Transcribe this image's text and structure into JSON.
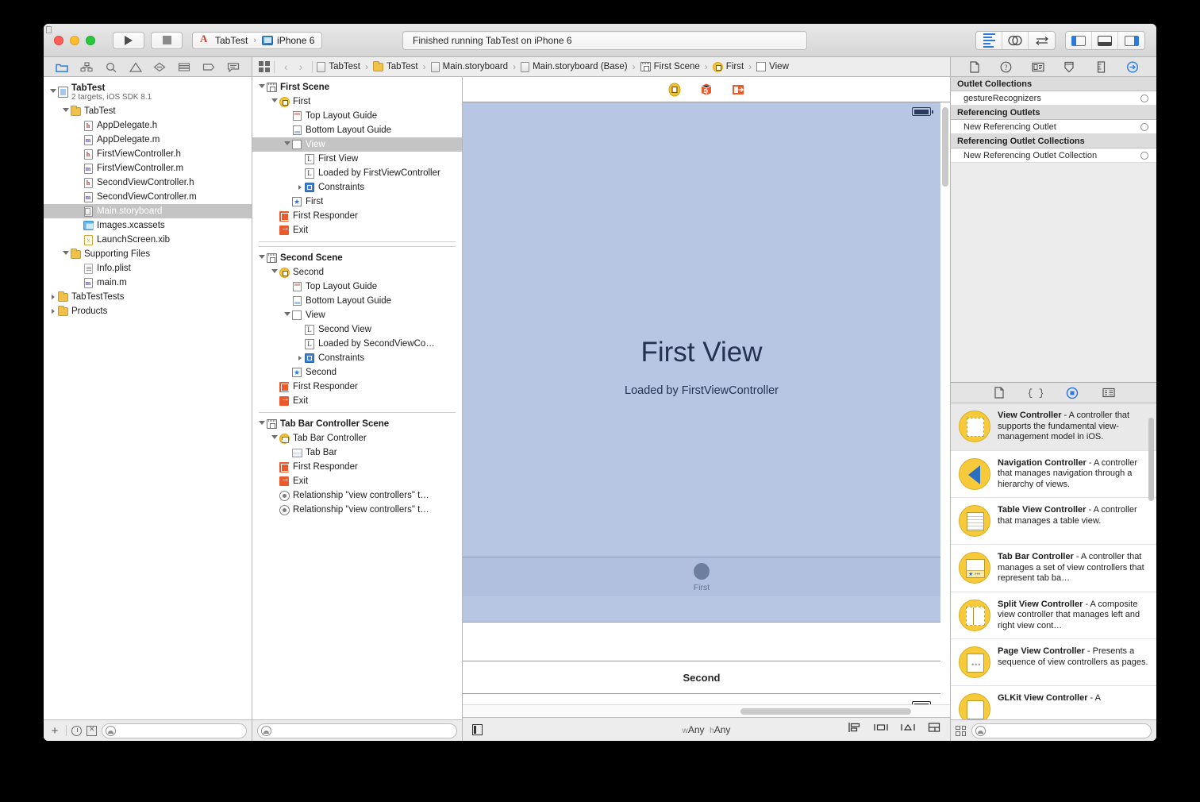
{
  "window": {
    "traffic_lights": [
      "close",
      "minimize",
      "zoom"
    ],
    "run_button": "run",
    "stop_button": "stop",
    "scheme": {
      "project": "TabTest",
      "separator": "›",
      "destination": "iPhone 6"
    },
    "status": "Finished running TabTest on iPhone 6",
    "editor_modes": [
      "standard-editor",
      "assistant-editor",
      "version-editor"
    ],
    "view_toggles": [
      "navigator-toggle",
      "debug-area-toggle",
      "utilities-toggle"
    ]
  },
  "navigator": {
    "tabs": [
      "project-navigator",
      "symbol-navigator",
      "find-navigator",
      "issue-navigator",
      "test-navigator",
      "debug-navigator",
      "breakpoint-navigator",
      "report-navigator"
    ],
    "tree": [
      {
        "label": "TabTest",
        "sublabel": "2 targets, iOS SDK 8.1",
        "icon": "project-icon",
        "depth": 0,
        "twisty": "open",
        "bold": true,
        "selected": false
      },
      {
        "label": "TabTest",
        "icon": "folder-icon",
        "depth": 1,
        "twisty": "open",
        "selected": false
      },
      {
        "label": "AppDelegate.h",
        "icon": "header-file-icon",
        "depth": 2,
        "twisty": "none",
        "selected": false
      },
      {
        "label": "AppDelegate.m",
        "icon": "source-file-icon",
        "depth": 2,
        "twisty": "none",
        "selected": false
      },
      {
        "label": "FirstViewController.h",
        "icon": "header-file-icon",
        "depth": 2,
        "twisty": "none",
        "selected": false
      },
      {
        "label": "FirstViewController.m",
        "icon": "source-file-icon",
        "depth": 2,
        "twisty": "none",
        "selected": false
      },
      {
        "label": "SecondViewController.h",
        "icon": "header-file-icon",
        "depth": 2,
        "twisty": "none",
        "selected": false
      },
      {
        "label": "SecondViewController.m",
        "icon": "source-file-icon",
        "depth": 2,
        "twisty": "none",
        "selected": false
      },
      {
        "label": "Main.storyboard",
        "icon": "storyboard-file-icon",
        "depth": 2,
        "twisty": "none",
        "selected": true
      },
      {
        "label": "Images.xcassets",
        "icon": "xcassets-icon",
        "depth": 2,
        "twisty": "none",
        "selected": false
      },
      {
        "label": "LaunchScreen.xib",
        "icon": "xib-file-icon",
        "depth": 2,
        "twisty": "none",
        "selected": false
      },
      {
        "label": "Supporting Files",
        "icon": "folder-icon",
        "depth": 1,
        "twisty": "open",
        "selected": false
      },
      {
        "label": "Info.plist",
        "icon": "plist-file-icon",
        "depth": 2,
        "twisty": "none",
        "selected": false
      },
      {
        "label": "main.m",
        "icon": "source-file-icon",
        "depth": 2,
        "twisty": "none",
        "selected": false
      },
      {
        "label": "TabTestTests",
        "icon": "folder-icon",
        "depth": 0,
        "twisty": "closed",
        "selected": false
      },
      {
        "label": "Products",
        "icon": "folder-icon",
        "depth": 0,
        "twisty": "closed",
        "selected": false
      }
    ],
    "filter": {
      "add_label": "+",
      "placeholder": ""
    }
  },
  "breadcrumb": {
    "back": "‹",
    "forward": "›",
    "separator": "›",
    "items": [
      {
        "label": "TabTest",
        "icon": "project-icon"
      },
      {
        "label": "TabTest",
        "icon": "folder-icon"
      },
      {
        "label": "Main.storyboard",
        "icon": "storyboard-file-icon"
      },
      {
        "label": "Main.storyboard (Base)",
        "icon": "storyboard-file-icon"
      },
      {
        "label": "First Scene",
        "icon": "scene-icon"
      },
      {
        "label": "First",
        "icon": "view-controller-icon"
      },
      {
        "label": "View",
        "icon": "view-icon"
      }
    ]
  },
  "outline": {
    "scenes": [
      {
        "name": "First Scene",
        "rows": [
          {
            "label": "First Scene",
            "icon": "scene-icon",
            "depth": 0,
            "twisty": "open",
            "bold": true,
            "selected": false
          },
          {
            "label": "First",
            "icon": "view-controller-icon",
            "depth": 1,
            "twisty": "open",
            "selected": false
          },
          {
            "label": "Top Layout Guide",
            "icon": "top-layout-guide-icon",
            "depth": 2,
            "twisty": "none",
            "selected": false
          },
          {
            "label": "Bottom Layout Guide",
            "icon": "bottom-layout-guide-icon",
            "depth": 2,
            "twisty": "none",
            "selected": false
          },
          {
            "label": "View",
            "icon": "view-icon",
            "depth": 2,
            "twisty": "open",
            "selected": true
          },
          {
            "label": "First View",
            "icon": "label-icon",
            "depth": 3,
            "twisty": "none",
            "selected": false
          },
          {
            "label": "Loaded by FirstViewController",
            "icon": "label-icon",
            "depth": 3,
            "twisty": "none",
            "selected": false
          },
          {
            "label": "Constraints",
            "icon": "constraints-icon",
            "depth": 3,
            "twisty": "closed",
            "selected": false
          },
          {
            "label": "First",
            "icon": "tab-bar-item-icon",
            "depth": 2,
            "twisty": "none",
            "selected": false
          },
          {
            "label": "First Responder",
            "icon": "first-responder-icon",
            "depth": 1,
            "twisty": "none",
            "selected": false
          },
          {
            "label": "Exit",
            "icon": "exit-icon",
            "depth": 1,
            "twisty": "none",
            "selected": false
          }
        ]
      },
      {
        "name": "Second Scene",
        "rows": [
          {
            "label": "Second Scene",
            "icon": "scene-icon",
            "depth": 0,
            "twisty": "open",
            "bold": true,
            "selected": false
          },
          {
            "label": "Second",
            "icon": "view-controller-icon",
            "depth": 1,
            "twisty": "open",
            "selected": false
          },
          {
            "label": "Top Layout Guide",
            "icon": "top-layout-guide-icon",
            "depth": 2,
            "twisty": "none",
            "selected": false
          },
          {
            "label": "Bottom Layout Guide",
            "icon": "bottom-layout-guide-icon",
            "depth": 2,
            "twisty": "none",
            "selected": false
          },
          {
            "label": "View",
            "icon": "view-icon",
            "depth": 2,
            "twisty": "open",
            "selected": false
          },
          {
            "label": "Second View",
            "icon": "label-icon",
            "depth": 3,
            "twisty": "none",
            "selected": false
          },
          {
            "label": "Loaded by SecondViewCo…",
            "icon": "label-icon",
            "depth": 3,
            "twisty": "none",
            "selected": false
          },
          {
            "label": "Constraints",
            "icon": "constraints-icon",
            "depth": 3,
            "twisty": "closed",
            "selected": false
          },
          {
            "label": "Second",
            "icon": "tab-bar-item-icon",
            "depth": 2,
            "twisty": "none",
            "selected": false
          },
          {
            "label": "First Responder",
            "icon": "first-responder-icon",
            "depth": 1,
            "twisty": "none",
            "selected": false
          },
          {
            "label": "Exit",
            "icon": "exit-icon",
            "depth": 1,
            "twisty": "none",
            "selected": false
          }
        ]
      },
      {
        "name": "Tab Bar Controller Scene",
        "rows": [
          {
            "label": "Tab Bar Controller Scene",
            "icon": "scene-icon",
            "depth": 0,
            "twisty": "open",
            "bold": true,
            "selected": false
          },
          {
            "label": "Tab Bar Controller",
            "icon": "tab-bar-controller-icon",
            "depth": 1,
            "twisty": "open",
            "selected": false
          },
          {
            "label": "Tab Bar",
            "icon": "tab-bar-icon",
            "depth": 2,
            "twisty": "none",
            "selected": false
          },
          {
            "label": "First Responder",
            "icon": "first-responder-icon",
            "depth": 1,
            "twisty": "none",
            "selected": false
          },
          {
            "label": "Exit",
            "icon": "exit-icon",
            "depth": 1,
            "twisty": "none",
            "selected": false
          },
          {
            "label": "Relationship \"view controllers\" t…",
            "icon": "relationship-icon",
            "depth": 1,
            "twisty": "none",
            "selected": false
          },
          {
            "label": "Relationship \"view controllers\" t…",
            "icon": "relationship-icon",
            "depth": 1,
            "twisty": "none",
            "selected": false
          }
        ]
      }
    ]
  },
  "canvas": {
    "scene_dock": [
      "view-controller-icon",
      "first-responder-icon",
      "exit-icon"
    ],
    "first_scene": {
      "title": "First View",
      "subtitle": "Loaded by FirstViewController",
      "tab_label": "First"
    },
    "second_scene": {
      "title": "Second"
    },
    "bottom_bar": {
      "size_class_w_prefix": "w",
      "size_class_w": "Any",
      "size_class_h_prefix": "h",
      "size_class_h": "Any",
      "buttons": [
        "document-outline-toggle",
        "align-button",
        "pin-button",
        "resolve-auto-layout-button",
        "resizing-behavior-button"
      ]
    }
  },
  "inspector": {
    "tabs": [
      "file-inspector",
      "quick-help-inspector",
      "identity-inspector",
      "attributes-inspector",
      "size-inspector",
      "connections-inspector"
    ],
    "active_tab": "connections-inspector",
    "sections": [
      {
        "title": "Outlet Collections",
        "rows": [
          {
            "label": "gestureRecognizers"
          }
        ]
      },
      {
        "title": "Referencing Outlets",
        "rows": [
          {
            "label": "New Referencing Outlet"
          }
        ]
      },
      {
        "title": "Referencing Outlet Collections",
        "rows": [
          {
            "label": "New Referencing Outlet Collection"
          }
        ]
      }
    ]
  },
  "library": {
    "tabs": [
      "file-template-library",
      "code-snippet-library",
      "object-library",
      "media-library"
    ],
    "active_tab": "object-library",
    "items": [
      {
        "name": "View Controller",
        "desc": " - A controller that supports the fundamental view-management model in iOS.",
        "icon": "view-controller-object-icon",
        "selected": true
      },
      {
        "name": "Navigation Controller",
        "desc": " - A controller that manages navigation through a hierarchy of views.",
        "icon": "navigation-controller-object-icon",
        "selected": false
      },
      {
        "name": "Table View Controller",
        "desc": " - A controller that manages a table view.",
        "icon": "table-view-controller-object-icon",
        "selected": false
      },
      {
        "name": "Tab Bar Controller",
        "desc": " - A controller that manages a set of view controllers that represent tab ba…",
        "icon": "tab-bar-controller-object-icon",
        "selected": false
      },
      {
        "name": "Split View Controller",
        "desc": " - A composite view controller that manages left and right view cont…",
        "icon": "split-view-controller-object-icon",
        "selected": false
      },
      {
        "name": "Page View Controller",
        "desc": " - Presents a sequence of view controllers as pages.",
        "icon": "page-view-controller-object-icon",
        "selected": false
      },
      {
        "name": "GLKit View Controller",
        "desc": " - A",
        "icon": "glkit-view-controller-object-icon",
        "selected": false
      }
    ],
    "filter_placeholder": ""
  }
}
